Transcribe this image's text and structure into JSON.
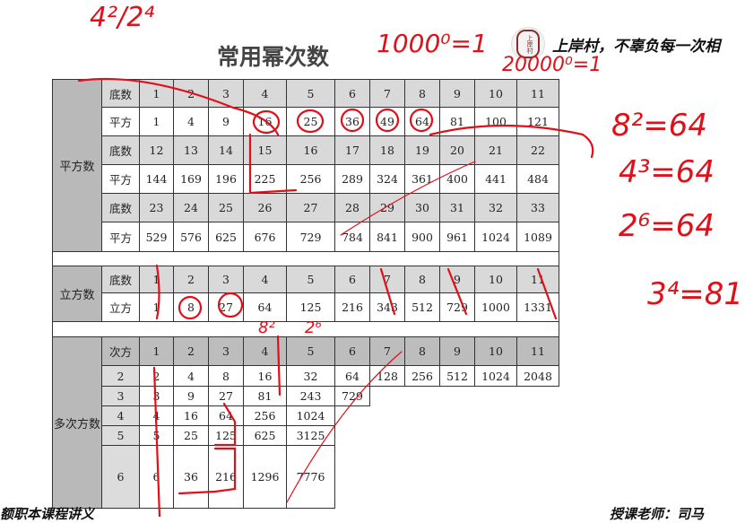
{
  "title": "常用幂次数",
  "brand": {
    "logo_text": "上岸村",
    "slogan": "上岸村，不辜负每一次相"
  },
  "footer": {
    "left": "额职本课程讲义",
    "right": "授课老师：司马"
  },
  "square": {
    "label": "平方数",
    "rows": [
      {
        "h": "底数",
        "v": [
          "1",
          "2",
          "3",
          "4",
          "5",
          "6",
          "7",
          "8",
          "9",
          "10",
          "11"
        ]
      },
      {
        "h": "平方",
        "v": [
          "1",
          "4",
          "9",
          "16",
          "25",
          "36",
          "49",
          "64",
          "81",
          "100",
          "121"
        ]
      },
      {
        "h": "底数",
        "v": [
          "12",
          "13",
          "14",
          "15",
          "16",
          "17",
          "18",
          "19",
          "20",
          "21",
          "22"
        ]
      },
      {
        "h": "平方",
        "v": [
          "144",
          "169",
          "196",
          "225",
          "256",
          "289",
          "324",
          "361",
          "400",
          "441",
          "484"
        ]
      },
      {
        "h": "底数",
        "v": [
          "23",
          "24",
          "25",
          "26",
          "27",
          "28",
          "29",
          "30",
          "31",
          "32",
          "33"
        ]
      },
      {
        "h": "平方",
        "v": [
          "529",
          "576",
          "625",
          "676",
          "729",
          "784",
          "841",
          "900",
          "961",
          "1024",
          "1089"
        ]
      }
    ]
  },
  "cube": {
    "label": "立方数",
    "rows": [
      {
        "h": "底数",
        "v": [
          "1",
          "2",
          "3",
          "4",
          "5",
          "6",
          "7",
          "8",
          "9",
          "10",
          "11"
        ]
      },
      {
        "h": "立方",
        "v": [
          "1",
          "8",
          "27",
          "64",
          "125",
          "216",
          "343",
          "512",
          "729",
          "1000",
          "1331"
        ]
      }
    ]
  },
  "multi": {
    "label": "多次方数",
    "header": {
      "h": "次方",
      "v": [
        "1",
        "2",
        "3",
        "4",
        "5",
        "6",
        "7",
        "8",
        "9",
        "10",
        "11"
      ]
    },
    "rows": [
      {
        "h": "2",
        "v": [
          "2",
          "4",
          "8",
          "16",
          "32",
          "64",
          "128",
          "256",
          "512",
          "1024",
          "2048"
        ]
      },
      {
        "h": "3",
        "v": [
          "3",
          "9",
          "27",
          "81",
          "243",
          "729"
        ]
      },
      {
        "h": "4",
        "v": [
          "4",
          "16",
          "64",
          "256",
          "1024"
        ]
      },
      {
        "h": "5",
        "v": [
          "5",
          "25",
          "125",
          "625",
          "3125"
        ]
      },
      {
        "h": "6",
        "v": [
          "6",
          "36",
          "216",
          "1296",
          "7776"
        ]
      }
    ]
  },
  "handwriting": {
    "a": "4²/2⁴",
    "b": "1000⁰=1",
    "c": "20000⁰=1",
    "d": "8²=64",
    "e": "4³=64",
    "f": "2⁶=64",
    "g": "3⁴=81",
    "h": "8²",
    "i": "2⁶"
  }
}
